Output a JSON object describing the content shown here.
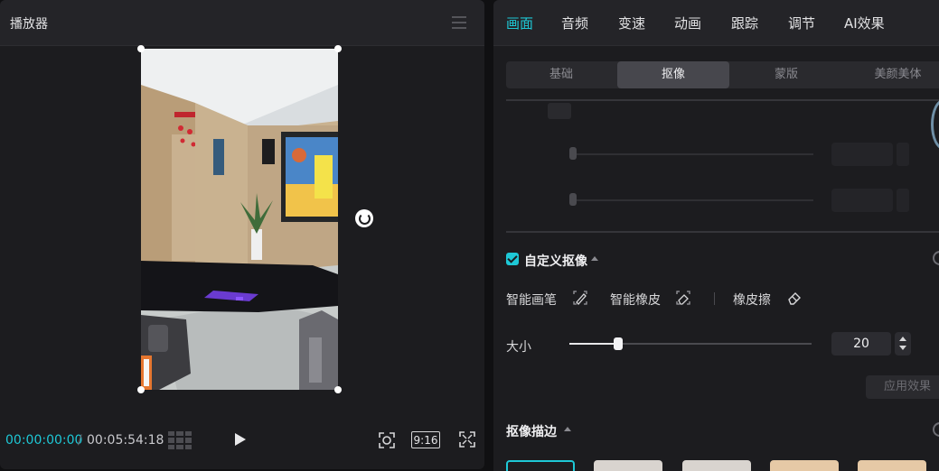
{
  "player": {
    "title": "播放器",
    "current_time": "00:00:00:00",
    "separator": "/",
    "total_time": "00:05:54:18",
    "aspect_ratio": "9:16"
  },
  "props": {
    "tabs": [
      {
        "label": "画面",
        "active": true
      },
      {
        "label": "音频"
      },
      {
        "label": "变速"
      },
      {
        "label": "动画"
      },
      {
        "label": "跟踪"
      },
      {
        "label": "调节"
      },
      {
        "label": "AI效果"
      }
    ],
    "subtabs": [
      {
        "label": "基础"
      },
      {
        "label": "抠像",
        "active": true
      },
      {
        "label": "蒙版"
      },
      {
        "label": "美颜美体"
      }
    ],
    "custom_matting": {
      "label": "自定义抠像",
      "checked": true,
      "tools": {
        "smart_brush": "智能画笔",
        "smart_eraser": "智能橡皮",
        "eraser": "橡皮擦"
      },
      "size_label": "大小",
      "size_value": "20",
      "size_fraction": 0.2,
      "apply_label": "应用效果"
    },
    "matting_stroke": {
      "label": "抠像描边"
    }
  },
  "colors": {
    "accent": "#1ec8d6",
    "panel_bg": "#1c1c1f",
    "header_bg": "#242428"
  }
}
